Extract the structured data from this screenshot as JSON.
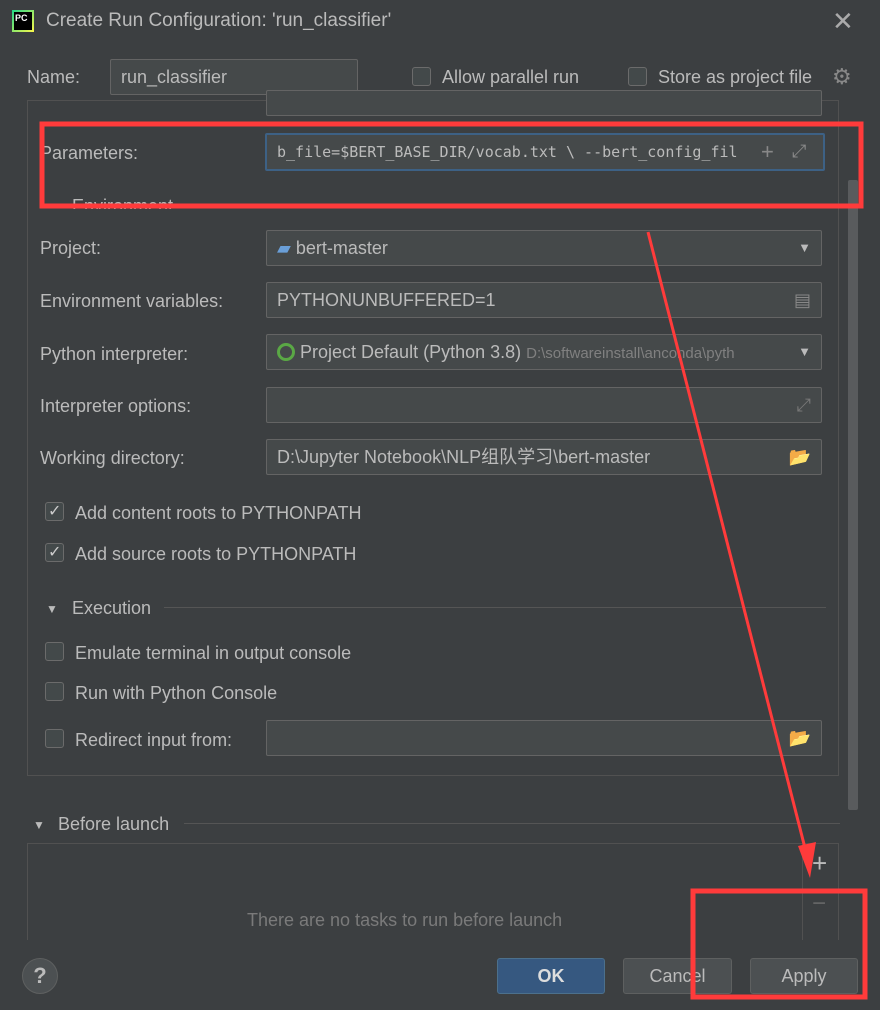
{
  "window": {
    "title": "Create Run Configuration: 'run_classifier'",
    "logo": "PC"
  },
  "name": {
    "label": "Name:",
    "value": "run_classifier"
  },
  "options": {
    "allow_parallel": "Allow parallel run",
    "allow_parallel_checked": false,
    "store_project": "Store as project file",
    "store_project_checked": false
  },
  "parameters": {
    "label": "Parameters:",
    "value": "b_file=$BERT_BASE_DIR/vocab.txt \\   --bert_config_fil"
  },
  "environment": {
    "section": "Environment",
    "project_label": "Project:",
    "project_value": "bert-master",
    "env_vars_label": "Environment variables:",
    "env_vars_value": "PYTHONUNBUFFERED=1",
    "interpreter_label": "Python interpreter:",
    "interpreter_value": "Project Default (Python 3.8)",
    "interpreter_path": "D:\\softwareinstall\\anconda\\pyth",
    "interp_options_label": "Interpreter options:",
    "interp_options_value": "",
    "workdir_label": "Working directory:",
    "workdir_value": "D:\\Jupyter Notebook\\NLP组队学习\\bert-master",
    "content_roots": "Add content roots to PYTHONPATH",
    "source_roots": "Add source roots to PYTHONPATH"
  },
  "execution": {
    "section": "Execution",
    "emulate": "Emulate terminal in output console",
    "python_console": "Run with Python Console",
    "redirect": "Redirect input from:",
    "redirect_value": ""
  },
  "before_launch": {
    "section": "Before launch",
    "empty": "There are no tasks to run before launch"
  },
  "buttons": {
    "help": "?",
    "ok": "OK",
    "cancel": "Cancel",
    "apply": "Apply"
  },
  "colors": {
    "background": "#3c3f41",
    "field": "#45494a",
    "ok_button": "#365880",
    "annotation": "#ff3b3b"
  }
}
